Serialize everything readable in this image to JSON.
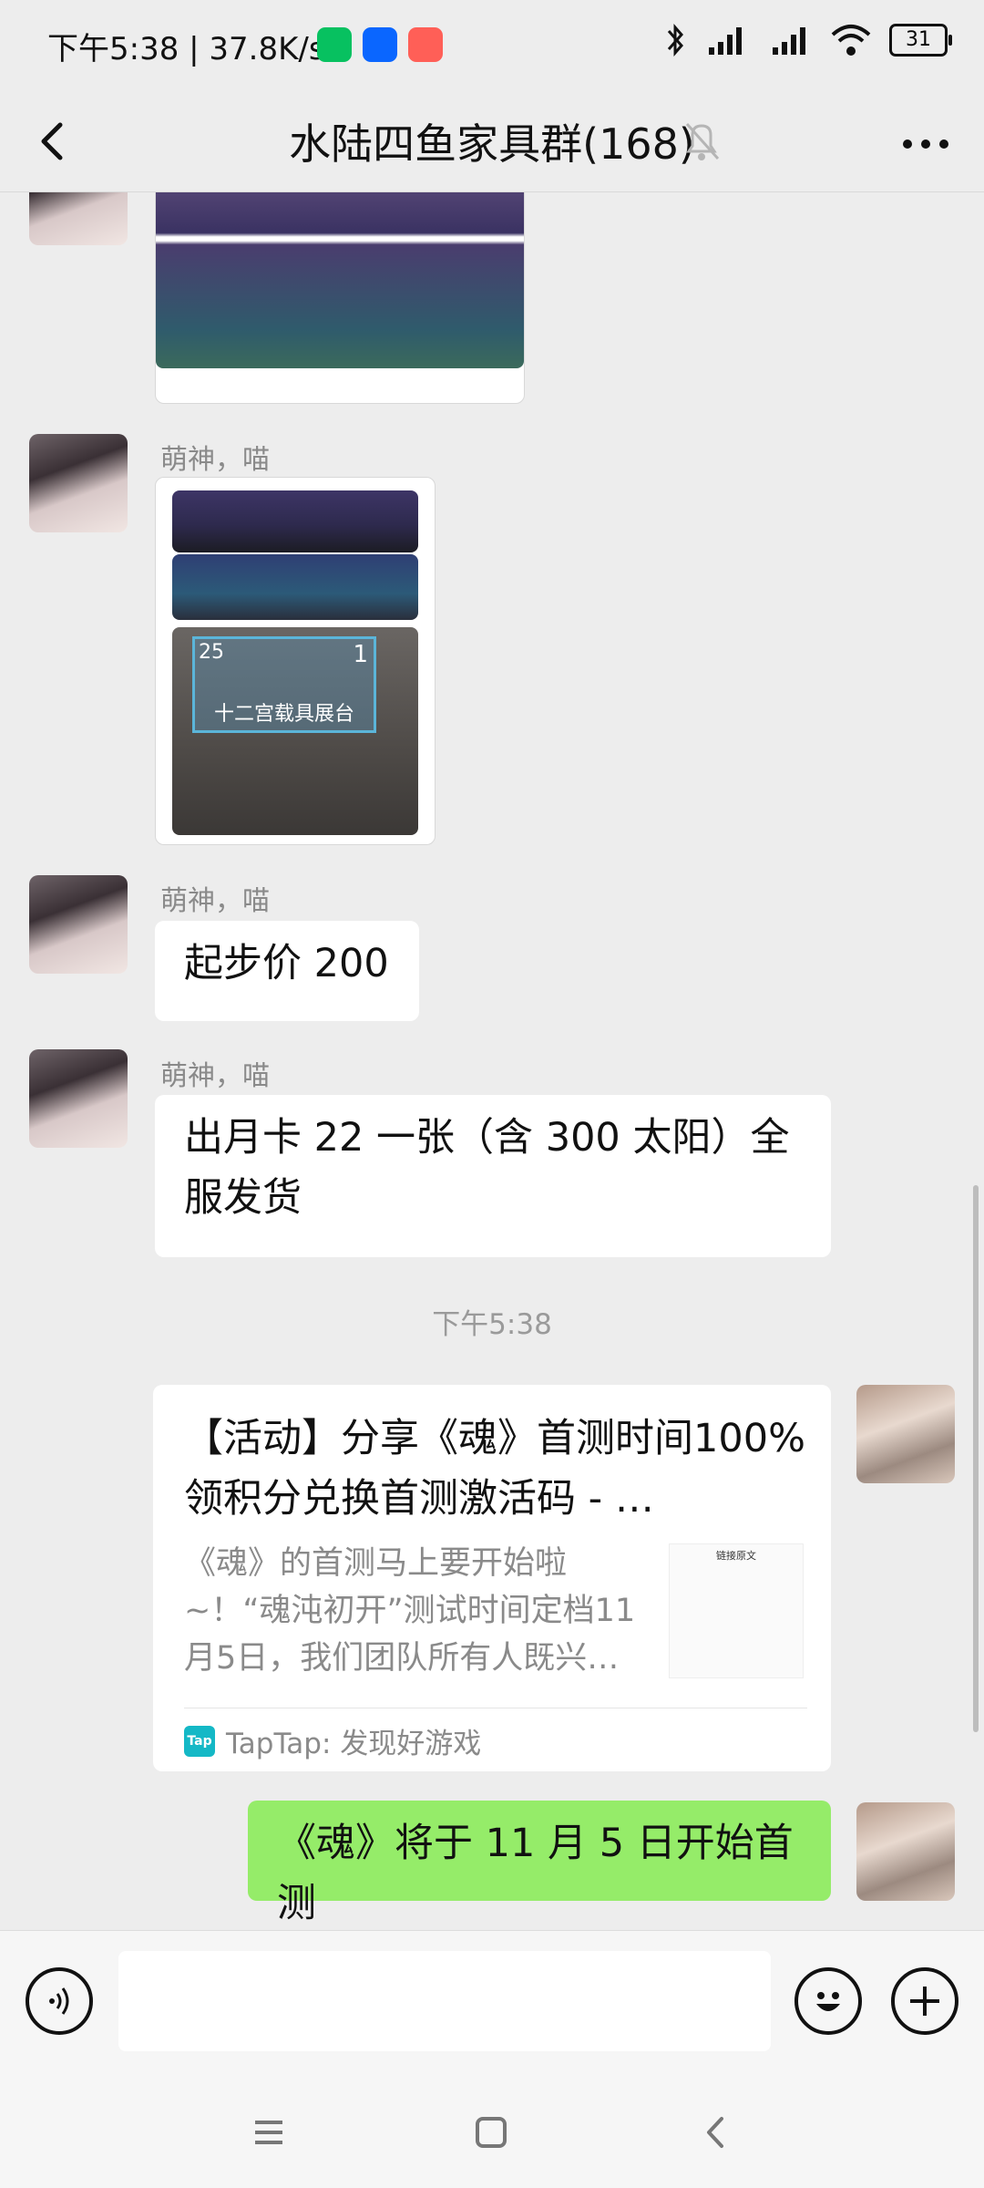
{
  "status_bar": {
    "time_speed": "下午5:38 | 37.8K/s",
    "battery": "31",
    "app_icons": [
      "wechat-icon",
      "zhihu-icon",
      "photo-app-icon"
    ],
    "right_icons": [
      "bluetooth-icon",
      "hd-signal-icon",
      "hd-signal-icon",
      "wifi-icon",
      "battery-icon"
    ]
  },
  "header": {
    "title": "水陆四鱼家具群(168)",
    "mute_icon": "bell-mute-icon"
  },
  "messages": [
    {
      "type": "image",
      "sender": "",
      "side": "left"
    },
    {
      "type": "images",
      "sender": "萌神，喵",
      "side": "left",
      "image_labels": [
        "25",
        "1",
        "十二宫载具展台"
      ]
    },
    {
      "type": "text",
      "sender": "萌神，喵",
      "text": "起步价 200",
      "side": "left"
    },
    {
      "type": "text",
      "sender": "萌神，喵",
      "text": "出月卡 22 一张（含 300 太阳）全服发货",
      "side": "left"
    },
    {
      "type": "time",
      "text": "下午5:38"
    },
    {
      "type": "link",
      "side": "right",
      "title": "【活动】分享《魂》首测时间100%领积分兑换首测激活码 - …",
      "description": "《魂》的首测马上要开始啦~！“魂沌初开”测试时间定档11月5日，我们团队所有人既兴…",
      "source": "TapTap: 发现好游戏",
      "thumb_caption": "链接原文"
    },
    {
      "type": "text",
      "side": "right",
      "text": "《魂》将于 11 月 5 日开始首测"
    }
  ],
  "colors": {
    "background": "#ededed",
    "my_bubble": "#95ec69",
    "other_bubble": "#ffffff",
    "taptap": "#14b8c6"
  }
}
